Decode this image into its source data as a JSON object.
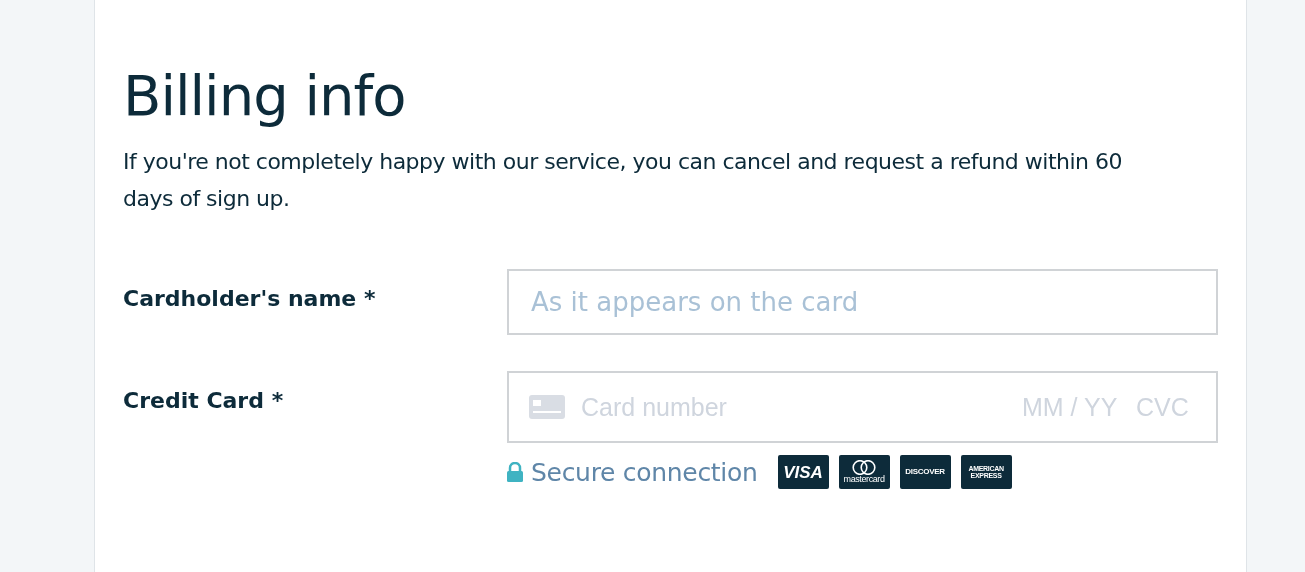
{
  "title": "Billing info",
  "intro": "If you're not completely happy with our service, you can cancel and request a refund within 60 days of sign up.",
  "fields": [
    {
      "kind": "text",
      "label": "Cardholder's name *",
      "placeholder": "As it appears on the card"
    },
    {
      "kind": "card",
      "label": "Credit Card *",
      "placeholder": "Card number",
      "expiry_placeholder": "MM / YY",
      "cvc_placeholder": "CVC"
    }
  ],
  "secure": "Secure connection",
  "card_brands": [
    {
      "kind": "visa",
      "text": "VISA"
    },
    {
      "kind": "mastercard",
      "text": "mastercard"
    },
    {
      "kind": "discover",
      "text": "DISCOVER"
    },
    {
      "kind": "amex",
      "text": "AMERICAN EXPRESS"
    }
  ]
}
